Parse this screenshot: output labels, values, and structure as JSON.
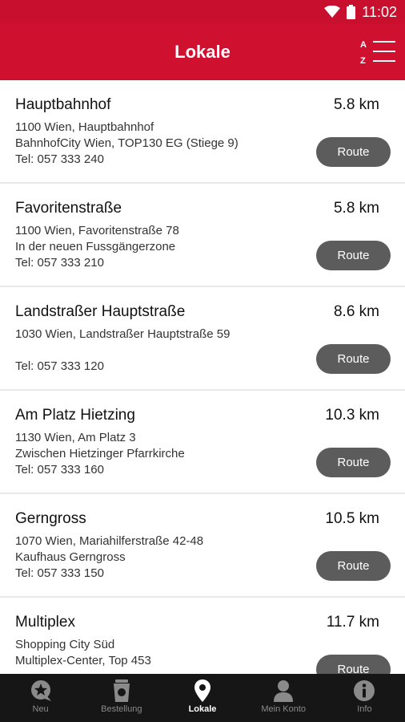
{
  "status_bar": {
    "time": "11:02"
  },
  "app_bar": {
    "title": "Lokale",
    "sort_top": "A",
    "sort_bottom": "Z"
  },
  "locations": [
    {
      "name": "Hauptbahnhof",
      "distance": "5.8 km",
      "address": "1100 Wien, Hauptbahnhof",
      "note": "BahnhofCity Wien, TOP130 EG (Stiege 9)",
      "phone": "Tel: 057 333 240",
      "route_label": "Route"
    },
    {
      "name": "Favoritenstraße",
      "distance": "5.8 km",
      "address": "1100 Wien, Favoritenstraße 78",
      "note": "In der neuen Fussgängerzone",
      "phone": "Tel: 057 333 210",
      "route_label": "Route"
    },
    {
      "name": "Landstraßer Hauptstraße",
      "distance": "8.6 km",
      "address": "1030 Wien, Landstraßer Hauptstraße 59",
      "note": "",
      "phone": "Tel: 057 333 120",
      "route_label": "Route"
    },
    {
      "name": "Am Platz Hietzing",
      "distance": "10.3 km",
      "address": "1130 Wien, Am Platz 3",
      "note": "Zwischen Hietzinger Pfarrkirche",
      "phone": "Tel: 057 333 160",
      "route_label": "Route"
    },
    {
      "name": "Gerngross",
      "distance": "10.5 km",
      "address": "1070 Wien, Mariahilferstraße 42-48",
      "note": "Kaufhaus Gerngross",
      "phone": "Tel: 057 333 150",
      "route_label": "Route"
    },
    {
      "name": "Multiplex",
      "distance": "11.7 km",
      "address": "Shopping City Süd",
      "note": "Multiplex-Center, Top 453",
      "phone": "",
      "route_label": "Route"
    }
  ],
  "bottom_nav": [
    {
      "label": "Neu",
      "icon": "star-chat-icon",
      "active": false
    },
    {
      "label": "Bestellung",
      "icon": "cup-icon",
      "active": false
    },
    {
      "label": "Lokale",
      "icon": "location-pin-icon",
      "active": true
    },
    {
      "label": "Mein Konto",
      "icon": "person-icon",
      "active": false
    },
    {
      "label": "Info",
      "icon": "info-icon",
      "active": false
    }
  ],
  "colors": {
    "brand_red": "#d0102f",
    "status_red": "#c8102e",
    "route_button": "#5c5c5c",
    "nav_bg": "#161616"
  }
}
